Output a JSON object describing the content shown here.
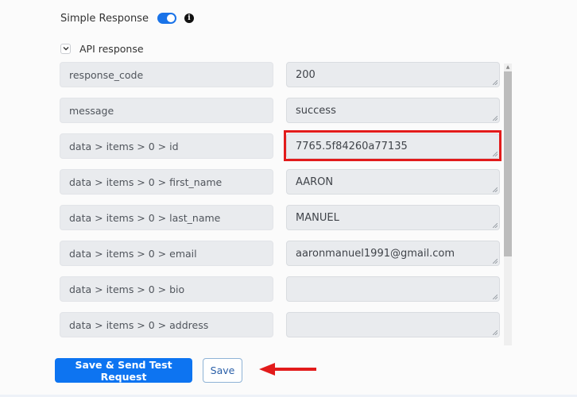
{
  "simple_response": {
    "label": "Simple Response",
    "toggle_on": true,
    "info_icon": "info-icon"
  },
  "api_response": {
    "label": "API response",
    "expanded": true,
    "rows": [
      {
        "key": "response_code",
        "value": "200"
      },
      {
        "key": "message",
        "value": "success"
      },
      {
        "key": "data > items > 0 > id",
        "value": "7765.5f84260a77135",
        "highlighted": true
      },
      {
        "key": "data > items > 0 > first_name",
        "value": "AARON"
      },
      {
        "key": "data > items > 0 > last_name",
        "value": "MANUEL"
      },
      {
        "key": "data > items > 0 > email",
        "value": "aaronmanuel1991@gmail.com"
      },
      {
        "key": "data > items > 0 > bio",
        "value": ""
      },
      {
        "key": "data > items > 0 > address",
        "value": ""
      }
    ]
  },
  "actions": {
    "save_send_label": "Save & Send Test Request",
    "save_label": "Save"
  },
  "colors": {
    "primary": "#0d74f1",
    "highlight": "#e21b1b",
    "toggle": "#1a73e8"
  }
}
